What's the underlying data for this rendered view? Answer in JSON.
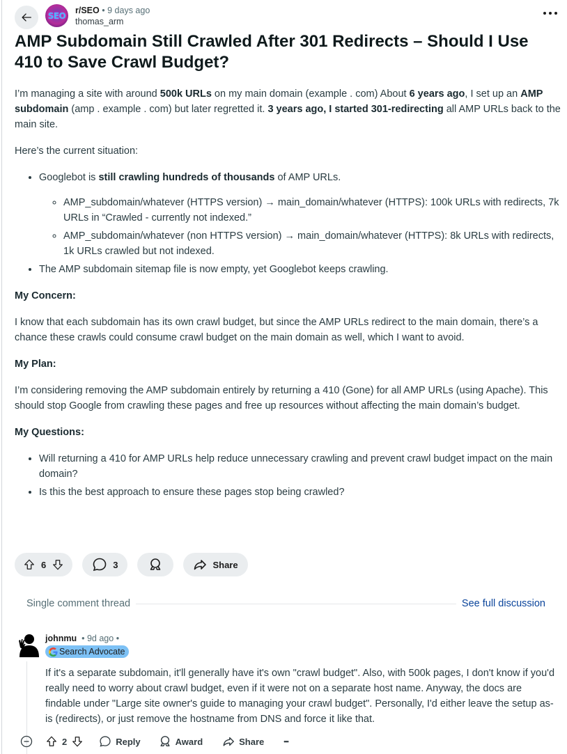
{
  "post": {
    "subreddit": "r/SEO",
    "separator": "•",
    "time_ago": "9 days ago",
    "author": "thomas_arm",
    "avatar_text": "SEO",
    "title": "AMP Subdomain Still Crawled After 301 Redirects – Should I Use 410 to Save Crawl Budget?",
    "body": {
      "intro": {
        "t1": "I’m managing a site with around ",
        "b1": "500k URLs",
        "t2": " on my main domain (example . com) About ",
        "b2": "6 years ago",
        "t3": ", I set up an ",
        "b3": "AMP subdomain",
        "t4": " (amp . example . com) but later regretted it. ",
        "b4": "3 years ago, I started 301-redirecting",
        "t5": " all AMP URLs back to the main site."
      },
      "situation_label": "Here’s the current situation:",
      "bullet1": {
        "t1": "Googlebot is ",
        "b1": "still crawling hundreds of thousands",
        "t2": " of AMP URLs."
      },
      "sub_bullets": [
        "AMP_subdomain/whatever (HTTPS version) → main_domain/whatever (HTTPS): 100k URLs with redirects, 7k URLs in “Crawled - currently not indexed.”",
        "AMP_subdomain/whatever (non HTTPS version) → main_domain/whatever (HTTPS): 8k URLs with redirects, 1k URLs crawled but not indexed."
      ],
      "bullet2": "The AMP subdomain sitemap file is now empty, yet Googlebot keeps crawling.",
      "concern_heading": "My Concern:",
      "concern_text": "I know that each subdomain has its own crawl budget, but since the AMP URLs redirect to the main domain, there’s a chance these crawls could consume crawl budget on the main domain as well, which I want to avoid.",
      "plan_heading": "My Plan:",
      "plan_text": "I’m considering removing the AMP subdomain entirely by returning a 410 (Gone) for all AMP URLs (using Apache). This should stop Google from crawling these pages and free up resources without affecting the main domain’s budget.",
      "questions_heading": "My Questions:",
      "questions": [
        "Will returning a 410 for AMP URLs help reduce unnecessary crawling and prevent crawl budget impact on the main domain?",
        "Is this the best approach to ensure these pages stop being crawled?"
      ]
    },
    "actions": {
      "votes": "6",
      "comments": "3",
      "share_label": "Share"
    }
  },
  "thread_bar": {
    "label": "Single comment thread",
    "link": "See full discussion"
  },
  "comment": {
    "author": "johnmu",
    "separator": "•",
    "time_ago": "9d ago",
    "flair_letter": "G",
    "flair_text": "Search Advocate",
    "body": "If it's a separate subdomain, it'll generally have it's own \"crawl budget\". Also, with 500k pages, I don't know if you'd really need to worry about crawl budget, even if it were not on a separate host name. Anyway, the docs are findable under \"Large site owner's guide to managing your crawl budget\". Personally, I'd either leave the setup as-is (redirects), or just remove the hostname from DNS and force it like that.",
    "actions": {
      "votes": "2",
      "reply_label": "Reply",
      "award_label": "Award",
      "share_label": "Share",
      "more_label": "•••"
    }
  },
  "icons": {
    "back": "arrow-left-icon",
    "more": "more-horizontal-icon",
    "upvote": "upvote-arrow-icon",
    "downvote": "downvote-arrow-icon",
    "comment": "speech-bubble-icon",
    "award": "award-ribbon-icon",
    "share": "share-arrow-icon",
    "collapse": "collapse-minus-icon"
  },
  "colors": {
    "pill_bg": "#eaedef",
    "link": "#0a449b",
    "flair_bg": "#7dc1f5",
    "meta_gray": "#576f76"
  }
}
